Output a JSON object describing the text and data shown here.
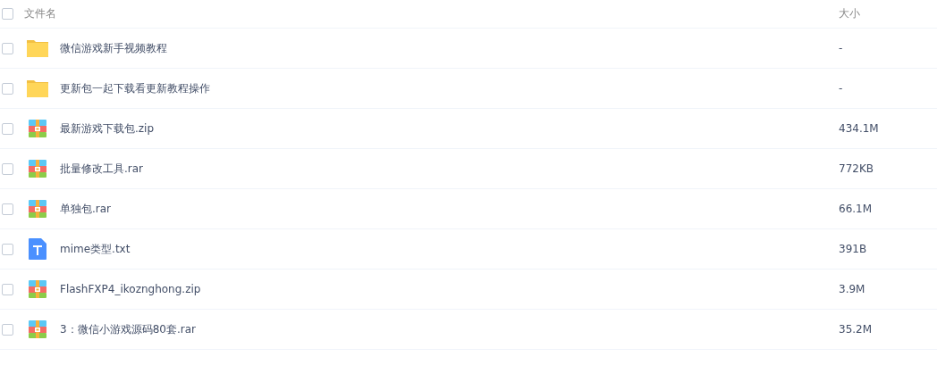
{
  "header": {
    "checked": false,
    "name": "文件名",
    "size": "大小"
  },
  "files": [
    {
      "kind": "folder",
      "checked": false,
      "name": "微信游戏新手视频教程",
      "size": "-"
    },
    {
      "kind": "folder",
      "checked": false,
      "name": "更新包一起下载看更新教程操作",
      "size": "-"
    },
    {
      "kind": "archive",
      "checked": false,
      "name": "最新游戏下载包.zip",
      "size": "434.1M"
    },
    {
      "kind": "archive",
      "checked": false,
      "name": "批量修改工具.rar",
      "size": "772KB"
    },
    {
      "kind": "archive",
      "checked": false,
      "name": "单独包.rar",
      "size": "66.1M"
    },
    {
      "kind": "text",
      "checked": false,
      "name": "mime类型.txt",
      "size": "391B"
    },
    {
      "kind": "archive",
      "checked": false,
      "name": "FlashFXP4_ikoznghong.zip",
      "size": "3.9M"
    },
    {
      "kind": "archive",
      "checked": false,
      "name": "3：微信小游戏源码80套.rar",
      "size": "35.2M"
    }
  ]
}
